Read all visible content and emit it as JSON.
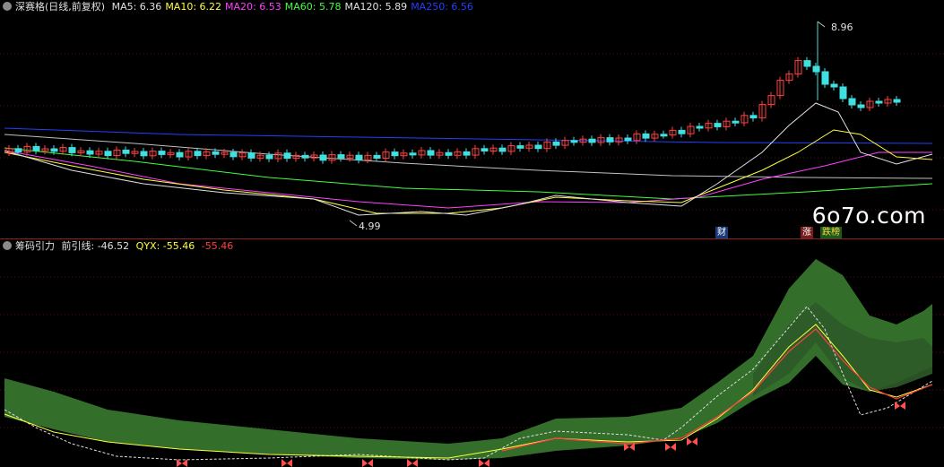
{
  "price_panel": {
    "security_name": "深赛格(日线,前复权)",
    "ma_legend": [
      {
        "label": "MA5: 6.36",
        "color": "#e0e0e0"
      },
      {
        "label": "MA10: 6.22",
        "color": "#ffff40"
      },
      {
        "label": "MA20: 6.53",
        "color": "#ff40ff"
      },
      {
        "label": "MA60: 5.78",
        "color": "#40ff40"
      },
      {
        "label": "MA120: 5.89",
        "color": "#e0e0e0"
      },
      {
        "label": "MA250: 6.56",
        "color": "#2040ff"
      }
    ],
    "high_marker": "8.96",
    "low_marker": "4.99",
    "event_tags": [
      {
        "text": "财",
        "bg": "#1a3a7a"
      },
      {
        "text": "涨",
        "bg": "#7a1a1a"
      },
      {
        "text": "跌榜",
        "bg": "#1a5a1a"
      }
    ]
  },
  "indicator_panel": {
    "name": "筹码引力",
    "line1_label": "前引线: -46.52",
    "line2_label": "QYX: -55.46",
    "line3_label": "-55.46",
    "colors": {
      "line1": "#e0e0e0",
      "line2": "#ffff40",
      "line3": "#ff4040",
      "band": "#3a7a30"
    }
  },
  "watermark": "6o7o.com",
  "colors": {
    "up": "#ff4040",
    "down": "#40e0e0",
    "background": "#000000",
    "grid": "#8a2020"
  },
  "icons": [
    "gear-icon",
    "butterfly-icon"
  ]
}
